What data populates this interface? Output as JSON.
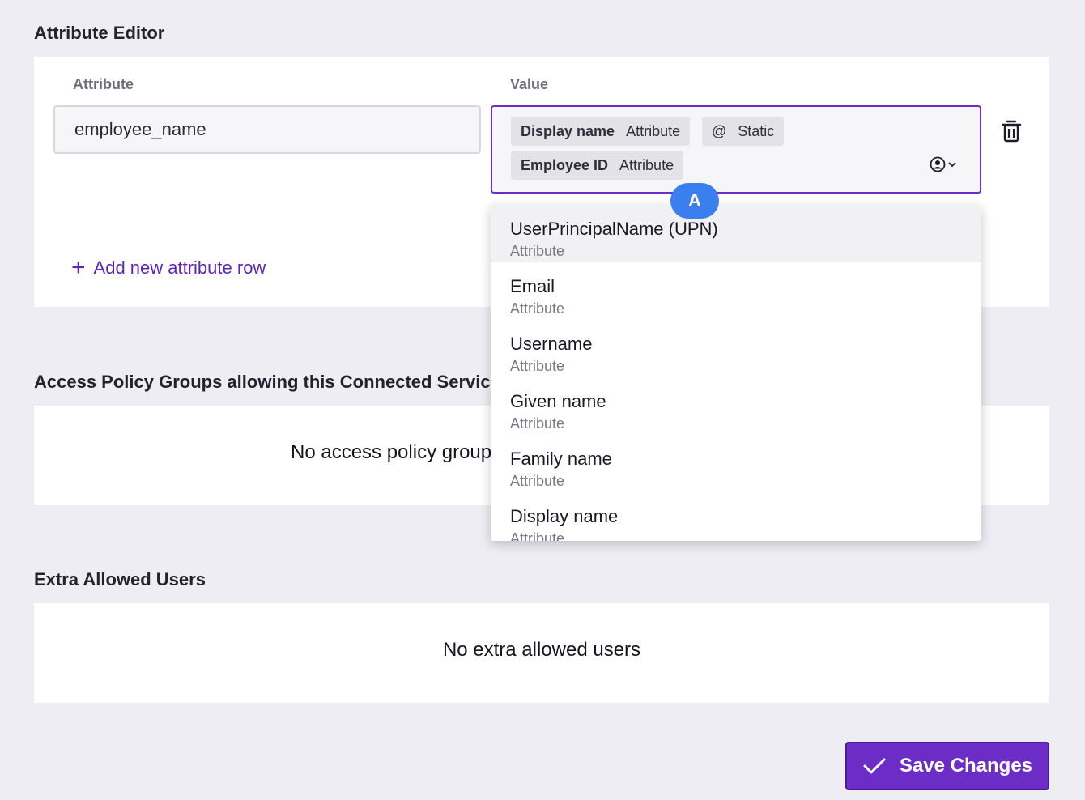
{
  "attribute_editor": {
    "title": "Attribute Editor",
    "attribute_label": "Attribute",
    "value_label": "Value",
    "attribute_value": "employee_name",
    "value_chips": [
      {
        "name": "Display name",
        "type": "Attribute"
      },
      {
        "prefix": "@",
        "type": "Static"
      },
      {
        "name": "Employee ID",
        "type": "Attribute"
      }
    ],
    "add_row_label": "Add new attribute row"
  },
  "dropdown": {
    "items": [
      {
        "name": "UserPrincipalName (UPN)",
        "type": "Attribute"
      },
      {
        "name": "Email",
        "type": "Attribute"
      },
      {
        "name": "Username",
        "type": "Attribute"
      },
      {
        "name": "Given name",
        "type": "Attribute"
      },
      {
        "name": "Family name",
        "type": "Attribute"
      },
      {
        "name": "Display name",
        "type": "Attribute"
      }
    ]
  },
  "cursor_badge": "A",
  "access_policy": {
    "title": "Access Policy Groups allowing this Connected Service",
    "empty_text": "No access policy groups"
  },
  "extra_users": {
    "title": "Extra Allowed Users",
    "empty_text": "No extra allowed users"
  },
  "save_label": "Save Changes",
  "colors": {
    "accent": "#6c2dc7",
    "background": "#eeedf3",
    "cursor_badge": "#3a7ff0"
  }
}
